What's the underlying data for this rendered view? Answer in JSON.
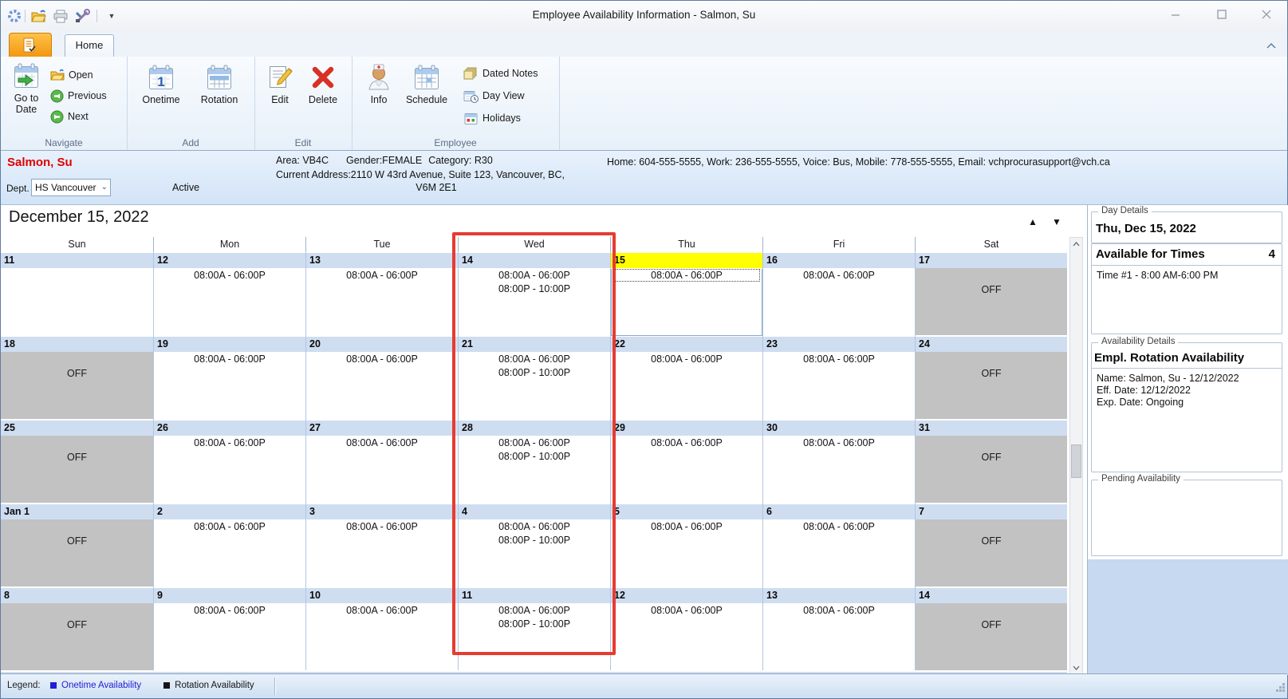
{
  "window": {
    "title": "Employee Availability Information - Salmon, Su",
    "quick_access_icons": [
      "app-spinner-icon",
      "open-folder-icon",
      "printer-icon",
      "tools-icon",
      "customize-arrow-icon"
    ],
    "controls": [
      "minimize",
      "maximize",
      "close"
    ]
  },
  "ribbon": {
    "tab": "Home",
    "groups": {
      "navigate": {
        "label": "Navigate",
        "goto_line1": "Go to",
        "goto_line2": "Date",
        "open": "Open",
        "previous": "Previous",
        "next": "Next"
      },
      "add": {
        "label": "Add",
        "onetime": "Onetime",
        "rotation": "Rotation"
      },
      "edit": {
        "label": "Edit",
        "edit_btn": "Edit",
        "delete_btn": "Delete"
      },
      "employee": {
        "label": "Employee",
        "info": "Info",
        "schedule": "Schedule",
        "dated_notes": "Dated Notes",
        "day_view": "Day View",
        "holidays": "Holidays"
      }
    }
  },
  "employee_bar": {
    "name": "Salmon, Su",
    "dept_label": "Dept.",
    "dept_value": "HS Vancouver",
    "status": "Active",
    "area": "Area: VB4C",
    "gender": "Gender:FEMALE",
    "category": "Category:  R30",
    "address_line1": "Current Address:2110 W 43rd Avenue, Suite 123, Vancouver, BC,",
    "address_line2": "V6M 2E1",
    "contact": "Home: 604-555-5555, Work: 236-555-5555, Voice: Bus, Mobile: 778-555-5555, Email: vchprocurasupport@vch.ca"
  },
  "calendar": {
    "title": "December 15, 2022",
    "dow": [
      "Sun",
      "Mon",
      "Tue",
      "Wed",
      "Thu",
      "Fri",
      "Sat"
    ],
    "off_label": "OFF",
    "weeks": [
      {
        "days": [
          {
            "date": "11",
            "kind": "empty"
          },
          {
            "date": "12",
            "kind": "work",
            "times": [
              "08:00A - 06:00P"
            ]
          },
          {
            "date": "13",
            "kind": "work",
            "times": [
              "08:00A - 06:00P"
            ]
          },
          {
            "date": "14",
            "kind": "work",
            "times": [
              "08:00A - 06:00P",
              "08:00P - 10:00P"
            ]
          },
          {
            "date": "15",
            "kind": "work",
            "times": [
              "08:00A - 06:00P"
            ],
            "today": true,
            "selected": true
          },
          {
            "date": "16",
            "kind": "work",
            "times": [
              "08:00A - 06:00P"
            ]
          },
          {
            "date": "17",
            "kind": "off"
          }
        ]
      },
      {
        "days": [
          {
            "date": "18",
            "kind": "off"
          },
          {
            "date": "19",
            "kind": "work",
            "times": [
              "08:00A - 06:00P"
            ]
          },
          {
            "date": "20",
            "kind": "work",
            "times": [
              "08:00A - 06:00P"
            ]
          },
          {
            "date": "21",
            "kind": "work",
            "times": [
              "08:00A - 06:00P",
              "08:00P - 10:00P"
            ]
          },
          {
            "date": "22",
            "kind": "work",
            "times": [
              "08:00A - 06:00P"
            ]
          },
          {
            "date": "23",
            "kind": "work",
            "times": [
              "08:00A - 06:00P"
            ]
          },
          {
            "date": "24",
            "kind": "off"
          }
        ]
      },
      {
        "days": [
          {
            "date": "25",
            "kind": "off"
          },
          {
            "date": "26",
            "kind": "work",
            "times": [
              "08:00A - 06:00P"
            ]
          },
          {
            "date": "27",
            "kind": "work",
            "times": [
              "08:00A - 06:00P"
            ]
          },
          {
            "date": "28",
            "kind": "work",
            "times": [
              "08:00A - 06:00P",
              "08:00P - 10:00P"
            ]
          },
          {
            "date": "29",
            "kind": "work",
            "times": [
              "08:00A - 06:00P"
            ]
          },
          {
            "date": "30",
            "kind": "work",
            "times": [
              "08:00A - 06:00P"
            ]
          },
          {
            "date": "31",
            "kind": "off"
          }
        ]
      },
      {
        "days": [
          {
            "date": "Jan 1",
            "kind": "off"
          },
          {
            "date": "2",
            "kind": "work",
            "times": [
              "08:00A - 06:00P"
            ]
          },
          {
            "date": "3",
            "kind": "work",
            "times": [
              "08:00A - 06:00P"
            ]
          },
          {
            "date": "4",
            "kind": "work",
            "times": [
              "08:00A - 06:00P",
              "08:00P - 10:00P"
            ]
          },
          {
            "date": "5",
            "kind": "work",
            "times": [
              "08:00A - 06:00P"
            ]
          },
          {
            "date": "6",
            "kind": "work",
            "times": [
              "08:00A - 06:00P"
            ]
          },
          {
            "date": "7",
            "kind": "off"
          }
        ]
      },
      {
        "days": [
          {
            "date": "8",
            "kind": "off"
          },
          {
            "date": "9",
            "kind": "work",
            "times": [
              "08:00A - 06:00P"
            ]
          },
          {
            "date": "10",
            "kind": "work",
            "times": [
              "08:00A - 06:00P"
            ]
          },
          {
            "date": "11",
            "kind": "work",
            "times": [
              "08:00A - 06:00P",
              "08:00P - 10:00P"
            ]
          },
          {
            "date": "12",
            "kind": "work",
            "times": [
              "08:00A - 06:00P"
            ]
          },
          {
            "date": "13",
            "kind": "work",
            "times": [
              "08:00A - 06:00P"
            ]
          },
          {
            "date": "14",
            "kind": "off"
          }
        ]
      }
    ]
  },
  "panel": {
    "day_details_label": "Day Details",
    "date_title": "Thu, Dec 15, 2022",
    "available_header": "Available for Times",
    "available_count": "4",
    "times": [
      "Time #1 - 8:00 AM-6:00 PM"
    ],
    "availability_details_label": "Availability Details",
    "availability_title": "Empl. Rotation Availability",
    "availability_lines": [
      "Name: Salmon, Su - 12/12/2022",
      "Eff. Date: 12/12/2022",
      "Exp. Date: Ongoing"
    ],
    "pending_label": "Pending Availability"
  },
  "status_bar": {
    "legend_label": "Legend:",
    "items": [
      {
        "label": "Onetime Availability",
        "color": "#1f1fd4"
      },
      {
        "label": "Rotation Availability",
        "color": "#141414"
      }
    ]
  },
  "colors": {
    "selected_day_header": "#ffff00",
    "off_cell": "#c2c2c2",
    "highlight_box": "#e63c30",
    "employee_name": "#e00000"
  }
}
